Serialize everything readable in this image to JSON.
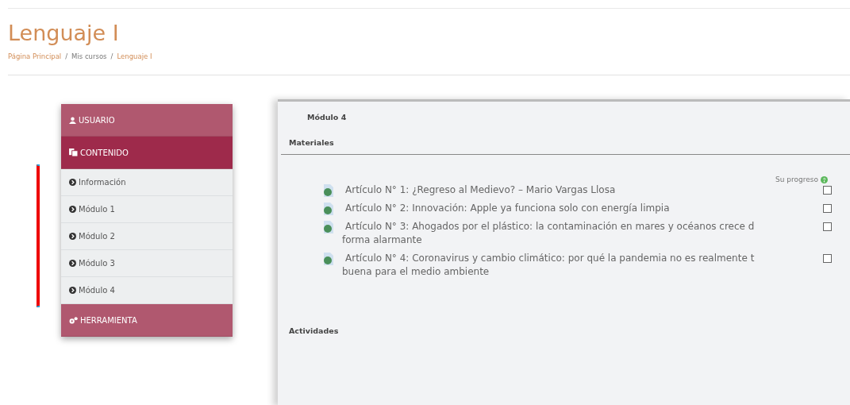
{
  "page": {
    "title": "Lenguaje I"
  },
  "breadcrumb": [
    {
      "label": "Página Principal",
      "link": true
    },
    {
      "separator": "/",
      "label": "Mis cursos",
      "link": false
    },
    {
      "separator": "/",
      "label": "Lenguaje I",
      "link": true
    }
  ],
  "sidebar": {
    "sections": [
      {
        "kind": "user",
        "label": "USUARIO",
        "selected": false
      },
      {
        "kind": "content",
        "label": "CONTENIDO",
        "selected": true,
        "children": [
          {
            "label": "Información"
          },
          {
            "label": "Módulo 1"
          },
          {
            "label": "Módulo 2"
          },
          {
            "label": "Módulo 3"
          },
          {
            "label": "Módulo 4"
          }
        ]
      },
      {
        "kind": "tools",
        "label": "HERRAMIENTA",
        "selected": false
      }
    ]
  },
  "main": {
    "heading": "Módulo 4",
    "materials_title": "Materiales",
    "progress_label": "Su progreso",
    "resources": [
      {
        "lines": [
          "Artículo N° 1: ¿Regreso al Medievo? – Mario Vargas Llosa"
        ],
        "checked": false
      },
      {
        "lines": [
          "Artículo N° 2: Innovación: Apple ya funciona solo con energía limpia"
        ],
        "checked": false
      },
      {
        "lines": [
          "Artículo N° 3: Ahogados por el plástico: la contaminación en mares y océanos crece d",
          "forma alarmante"
        ],
        "checked": false
      },
      {
        "lines": [
          "Artículo N° 4: Coronavirus y cambio climático: por qué la pandemia no es realmente t",
          "buena para el medio ambiente"
        ],
        "checked": false
      }
    ],
    "activities_title": "Actividades"
  }
}
